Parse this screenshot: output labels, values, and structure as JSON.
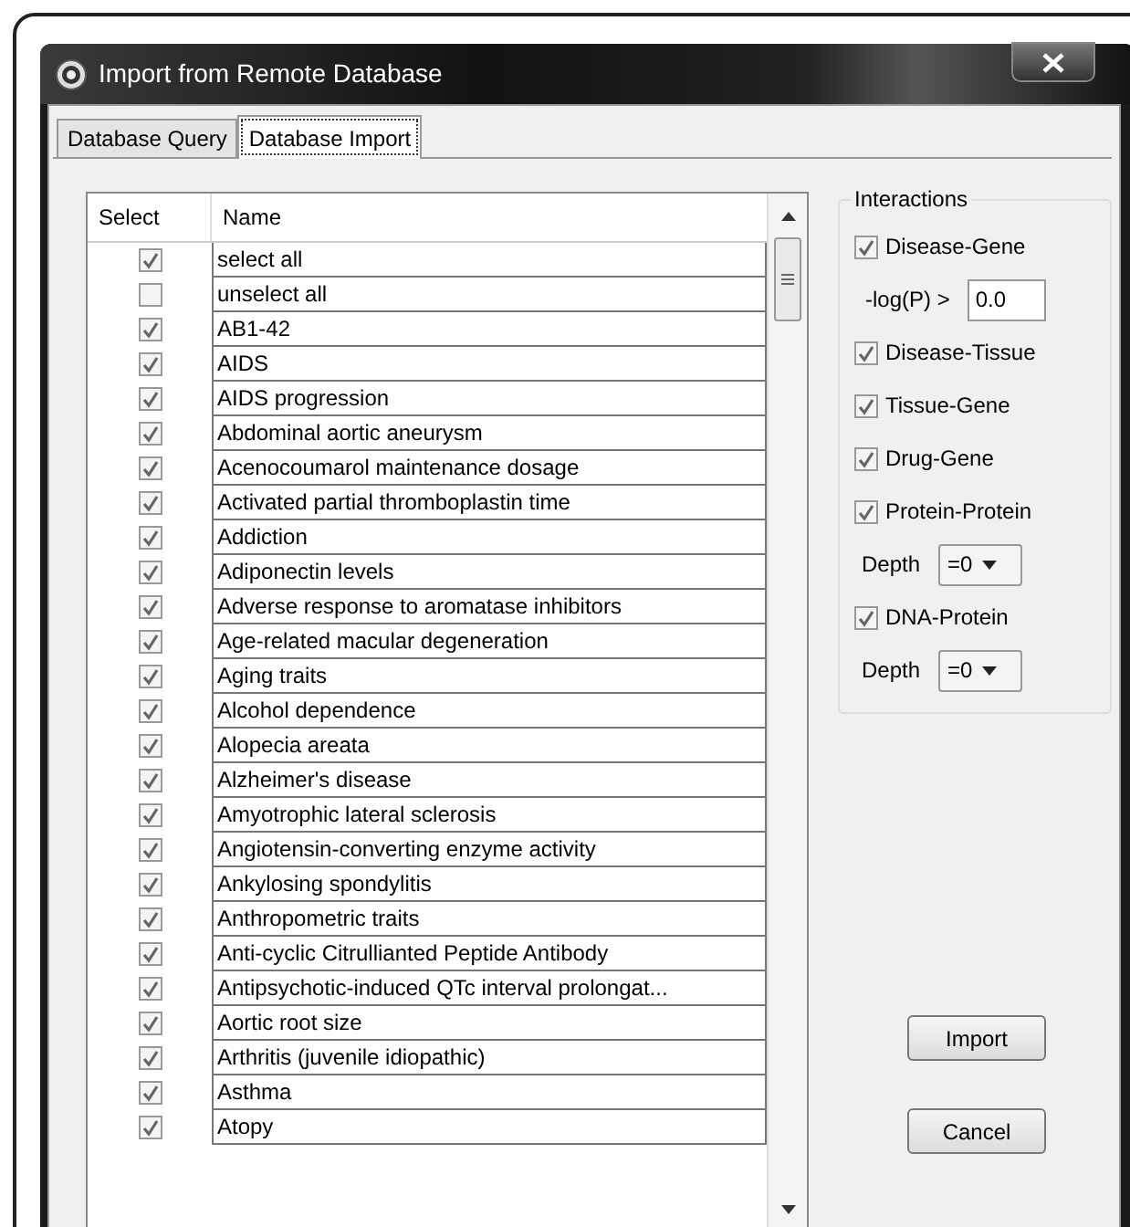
{
  "window": {
    "title": "Import from Remote Database"
  },
  "tabs": [
    {
      "label": "Database Query",
      "selected": false
    },
    {
      "label": "Database Import",
      "selected": true
    }
  ],
  "table": {
    "columns": [
      "Select",
      "Name"
    ],
    "rows": [
      {
        "name": "select all",
        "checked": true
      },
      {
        "name": "unselect all",
        "checked": false
      },
      {
        "name": "AB1-42",
        "checked": true
      },
      {
        "name": "AIDS",
        "checked": true
      },
      {
        "name": "AIDS progression",
        "checked": true
      },
      {
        "name": "Abdominal aortic aneurysm",
        "checked": true
      },
      {
        "name": "Acenocoumarol maintenance dosage",
        "checked": true
      },
      {
        "name": "Activated partial thromboplastin time",
        "checked": true
      },
      {
        "name": "Addiction",
        "checked": true
      },
      {
        "name": "Adiponectin levels",
        "checked": true
      },
      {
        "name": "Adverse response to aromatase inhibitors",
        "checked": true
      },
      {
        "name": "Age-related macular degeneration",
        "checked": true
      },
      {
        "name": "Aging traits",
        "checked": true
      },
      {
        "name": "Alcohol dependence",
        "checked": true
      },
      {
        "name": "Alopecia areata",
        "checked": true
      },
      {
        "name": "Alzheimer's disease",
        "checked": true
      },
      {
        "name": "Amyotrophic lateral sclerosis",
        "checked": true
      },
      {
        "name": "Angiotensin-converting enzyme activity",
        "checked": true
      },
      {
        "name": "Ankylosing spondylitis",
        "checked": true
      },
      {
        "name": "Anthropometric traits",
        "checked": true
      },
      {
        "name": "Anti-cyclic Citrullianted Peptide Antibody",
        "checked": true
      },
      {
        "name": "Antipsychotic-induced QTc interval prolongat...",
        "checked": true
      },
      {
        "name": "Aortic root size",
        "checked": true
      },
      {
        "name": "Arthritis (juvenile idiopathic)",
        "checked": true
      },
      {
        "name": "Asthma",
        "checked": true
      },
      {
        "name": "Atopy",
        "checked": true
      }
    ]
  },
  "interactions": {
    "title": "Interactions",
    "items": [
      {
        "kind": "checkbox",
        "label": "Disease-Gene",
        "checked": true
      },
      {
        "kind": "field",
        "label": "-log(P) >",
        "value": "0.0"
      },
      {
        "kind": "checkbox",
        "label": "Disease-Tissue",
        "checked": true
      },
      {
        "kind": "checkbox",
        "label": "Tissue-Gene",
        "checked": true
      },
      {
        "kind": "checkbox",
        "label": "Drug-Gene",
        "checked": true
      },
      {
        "kind": "checkbox",
        "label": "Protein-Protein",
        "checked": true
      },
      {
        "kind": "dropdown",
        "label": "Depth",
        "value": "=0"
      },
      {
        "kind": "checkbox",
        "label": "DNA-Protein",
        "checked": true
      },
      {
        "kind": "dropdown",
        "label": "Depth",
        "value": "=0"
      }
    ]
  },
  "buttons": [
    "Import",
    "Cancel"
  ]
}
